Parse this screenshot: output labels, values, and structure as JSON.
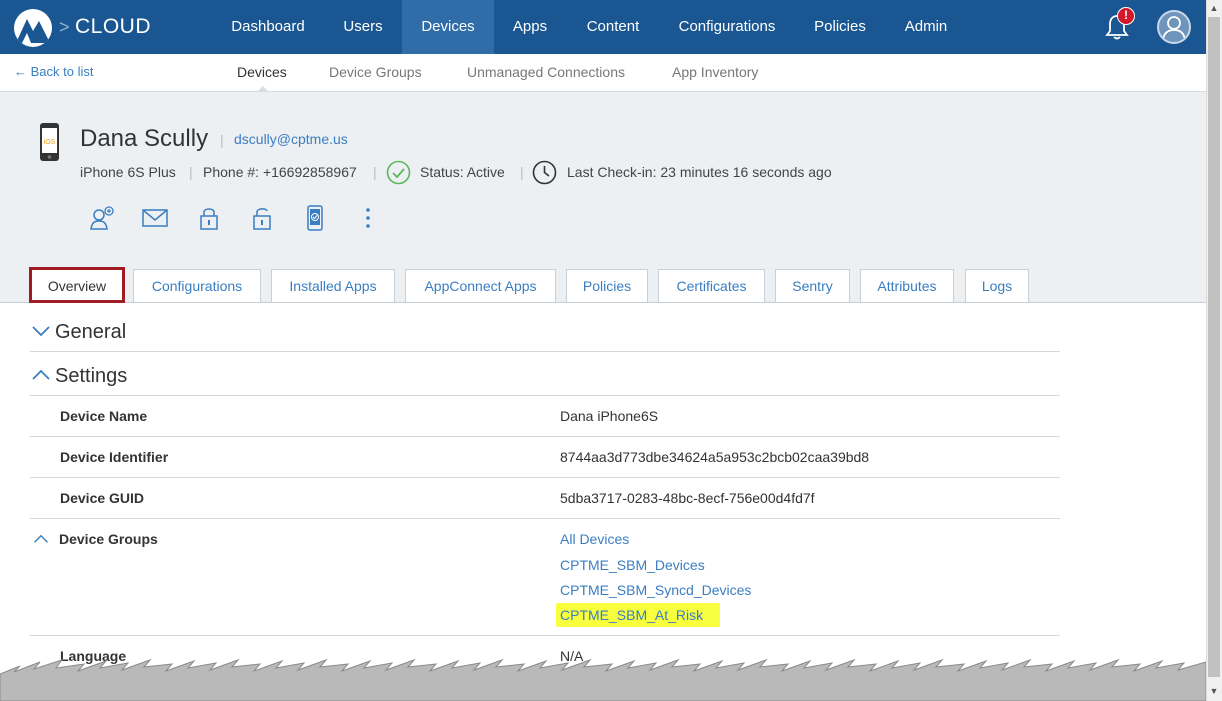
{
  "brand": {
    "name": "CLOUD",
    "logo": "mobileiron-logo",
    "separator": ">"
  },
  "nav": {
    "items": [
      {
        "label": "Dashboard"
      },
      {
        "label": "Users"
      },
      {
        "label": "Devices",
        "active": true
      },
      {
        "label": "Apps"
      },
      {
        "label": "Content"
      },
      {
        "label": "Configurations"
      },
      {
        "label": "Policies"
      },
      {
        "label": "Admin"
      }
    ],
    "notification_badge": "!",
    "colors": {
      "bar": "#1a5792",
      "active": "#2f6ca8",
      "badge": "#d2182b"
    }
  },
  "subnav": {
    "back_label": "← Back to list",
    "tabs": [
      {
        "label": "Devices",
        "active": true
      },
      {
        "label": "Device Groups"
      },
      {
        "label": "Unmanaged Connections"
      },
      {
        "label": "App Inventory"
      }
    ]
  },
  "device": {
    "name": "Dana Scully",
    "email": "dscully@cptme.us",
    "os_badge": "iOS",
    "model": "iPhone 6S Plus",
    "phone": "Phone #: +16692858967",
    "status": "Status: Active",
    "last_checkin": "Last Check-in: 23 minutes 16 seconds ago",
    "status_color": "#5cb85c"
  },
  "actions": [
    "assign-user-icon",
    "message-icon",
    "lock-icon",
    "unlock-icon",
    "device-check-icon",
    "more-icon"
  ],
  "tabs": [
    {
      "label": "Overview",
      "active": true
    },
    {
      "label": "Configurations"
    },
    {
      "label": "Installed Apps"
    },
    {
      "label": "AppConnect Apps"
    },
    {
      "label": "Policies"
    },
    {
      "label": "Certificates"
    },
    {
      "label": "Sentry"
    },
    {
      "label": "Attributes"
    },
    {
      "label": "Logs"
    }
  ],
  "sections": {
    "general": {
      "title": "General",
      "expanded": false
    },
    "settings": {
      "title": "Settings",
      "expanded": true
    }
  },
  "settings_rows": [
    {
      "label": "Device Name",
      "value": "Dana iPhone6S"
    },
    {
      "label": "Device Identifier",
      "value": "8744aa3d773dbe34624a5a953c2bcb02caa39bd8"
    },
    {
      "label": "Device GUID",
      "value": "5dba3717-0283-48bc-8ecf-756e00d4fd7f"
    }
  ],
  "device_groups": {
    "label": "Device Groups",
    "items": [
      "All Devices",
      "CPTME_SBM_Devices",
      "CPTME_SBM_Syncd_Devices",
      "CPTME_SBM_At_Risk"
    ],
    "highlighted_item": "CPTME_SBM_At_Risk",
    "highlight_color": "#f7ff3f"
  },
  "language": {
    "label": "Language",
    "value": "N/A"
  }
}
